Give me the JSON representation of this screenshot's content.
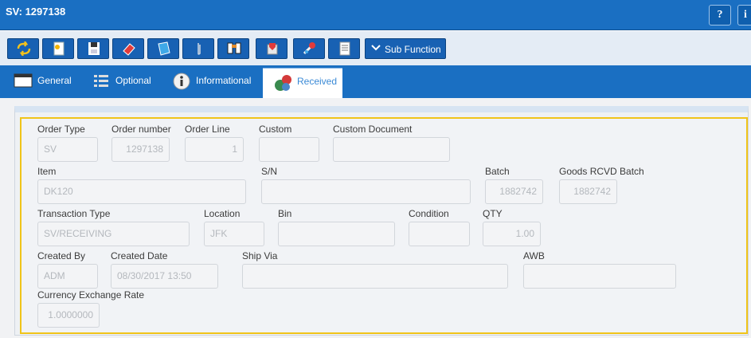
{
  "window": {
    "title": "SV: 1297138",
    "help_label": "?",
    "info_label": "i"
  },
  "toolbar": {
    "buttons": [
      "refresh-icon",
      "new-document-icon",
      "save-icon",
      "eraser-icon",
      "book-icon",
      "attach-icon",
      "binoculars-icon",
      "export-icon",
      "tools-icon",
      "report-icon"
    ],
    "sub_function_label": "Sub Function"
  },
  "tabs": [
    {
      "label": "General",
      "icon": "window-icon"
    },
    {
      "label": "Optional",
      "icon": "list-icon"
    },
    {
      "label": "Informational",
      "icon": "info-icon"
    },
    {
      "label": "Received",
      "icon": "received-icon",
      "active": true
    }
  ],
  "form": {
    "order_type": {
      "label": "Order Type",
      "value": "SV"
    },
    "order_number": {
      "label": "Order number",
      "value": "1297138"
    },
    "order_line": {
      "label": "Order Line",
      "value": "1"
    },
    "custom": {
      "label": "Custom",
      "value": ""
    },
    "custom_document": {
      "label": "Custom Document",
      "value": ""
    },
    "item": {
      "label": "Item",
      "value": "DK120"
    },
    "sn": {
      "label": "S/N",
      "value": ""
    },
    "batch": {
      "label": "Batch",
      "value": "1882742"
    },
    "goods_rcvd_batch": {
      "label": "Goods RCVD Batch",
      "value": "1882742"
    },
    "transaction_type": {
      "label": "Transaction Type",
      "value": "SV/RECEIVING"
    },
    "location": {
      "label": "Location",
      "value": "JFK"
    },
    "bin": {
      "label": "Bin",
      "value": ""
    },
    "condition": {
      "label": "Condition",
      "value": ""
    },
    "qty": {
      "label": "QTY",
      "value": "1.00"
    },
    "created_by": {
      "label": "Created By",
      "value": "ADM"
    },
    "created_date": {
      "label": "Created Date",
      "value": "08/30/2017 13:50"
    },
    "ship_via": {
      "label": "Ship Via",
      "value": ""
    },
    "awb": {
      "label": "AWB",
      "value": ""
    },
    "currency_exchange_rate": {
      "label": "Currency Exchange Rate",
      "value": "1.0000000"
    }
  },
  "colors": {
    "header_blue": "#1a6fc2",
    "button_blue": "#1861b3",
    "form_border": "#f0c419",
    "active_tab_text": "#3b8ad6"
  }
}
